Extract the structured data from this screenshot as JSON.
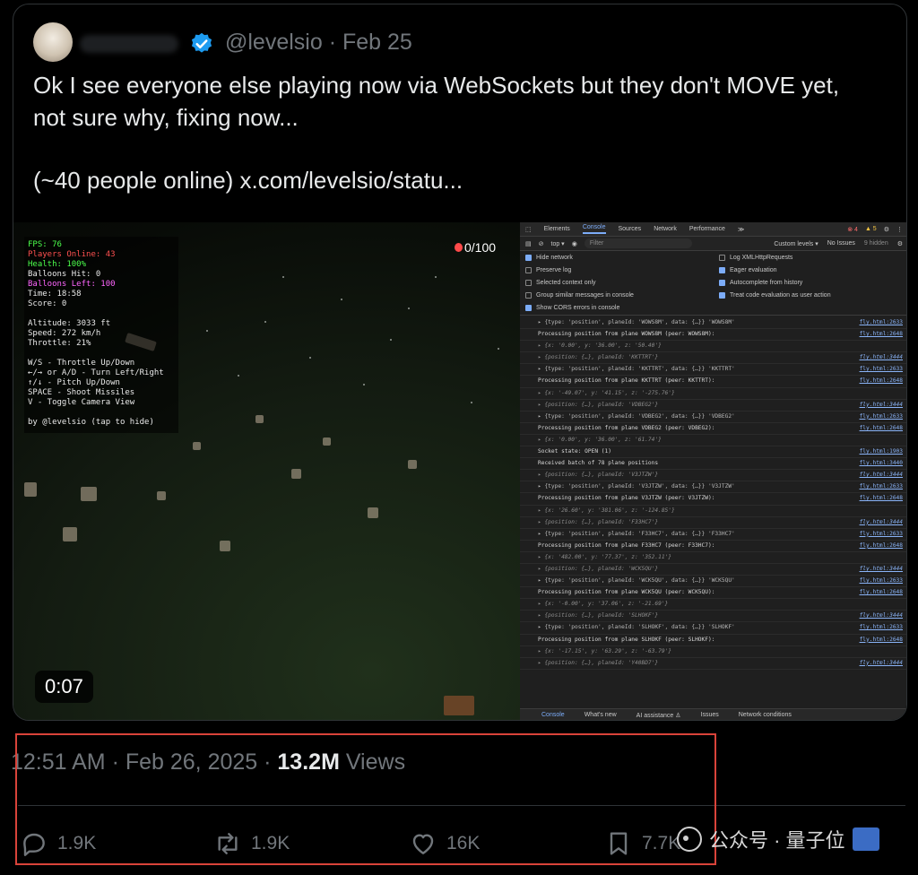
{
  "tweet": {
    "handle_date": "@levelsio · Feb 25",
    "line1": "Ok I see everyone else playing now via WebSockets but they don't MOVE yet,",
    "line2": "not sure why, fixing now...",
    "line3": "(~40 people online)  x.com/levelsio/statu..."
  },
  "game": {
    "hud": {
      "fps": "FPS: 76",
      "players": "Players Online: 43",
      "health": "Health: 100%",
      "balloons_hit": "Balloons Hit: 0",
      "balloons_left": "Balloons Left: 100",
      "time": "Time: 18:58",
      "score": "Score: 0",
      "altitude": "Altitude: 3033 ft",
      "speed": "Speed: 272 km/h",
      "throttle": "Throttle: 21%",
      "ctrl1": "W/S - Throttle Up/Down",
      "ctrl2": "←/→ or A/D - Turn Left/Right",
      "ctrl3": "↑/↓ - Pitch Up/Down",
      "ctrl4": "SPACE - Shoot Missiles",
      "ctrl5": "V - Toggle Camera View",
      "credit": "by @levelsio (tap to hide)"
    },
    "balloon_counter": "0/100",
    "video_time": "0:07"
  },
  "devtools": {
    "tabs": [
      "Elements",
      "Console",
      "Sources",
      "Network",
      "Performance",
      "≫"
    ],
    "errors": "⊗ 4",
    "warnings": "▲ 5",
    "filter": {
      "context": "top ▾",
      "placeholder": "Filter",
      "levels": "Custom levels ▾",
      "issues": "No Issues",
      "hidden": "9 hidden"
    },
    "settings": {
      "hide_network": "Hide network",
      "log_xhr": "Log XMLHttpRequests",
      "preserve_log": "Preserve log",
      "eager_eval": "Eager evaluation",
      "selected_context": "Selected context only",
      "autocomplete": "Autocomplete from history",
      "group_similar": "Group similar messages in console",
      "treat_eval": "Treat code evaluation as user action",
      "cors_errors": "Show CORS errors in console"
    },
    "logs": [
      {
        "text": "▸ {type: 'position', planeId: 'WOWS8M', data: {…}} 'WOWS8M'",
        "src": "fly.html:2633"
      },
      {
        "text": "Processing position from plane WOWS8M (peer: WOWS8M):",
        "src": "fly.html:2648"
      },
      {
        "text": "▸ {x: '0.00', y: '36.00', z: '50.40'}",
        "src": ""
      },
      {
        "text": "▸ {position: {…}, planeId: 'KKTTRT'}",
        "src": "fly.html:3444"
      },
      {
        "text": "▸ {type: 'position', planeId: 'KKTTRT', data: {…}} 'KKTTRT'",
        "src": "fly.html:2633"
      },
      {
        "text": "Processing position from plane KKTTRT (peer: KKTTRT):",
        "src": "fly.html:2648"
      },
      {
        "text": "▸ {x: '-49.07', y: '41.15', z: '-275.76'}",
        "src": ""
      },
      {
        "text": "▸ {position: {…}, planeId: 'VDBEG2'}",
        "src": "fly.html:3444"
      },
      {
        "text": "▸ {type: 'position', planeId: 'VDBEG2', data: {…}} 'VDBEG2'",
        "src": "fly.html:2633"
      },
      {
        "text": "Processing position from plane VDBEG2 (peer: VDBEG2):",
        "src": "fly.html:2648"
      },
      {
        "text": "▸ {x: '0.00', y: '36.00', z: '61.74'}",
        "src": ""
      },
      {
        "text": "Socket state: OPEN (1)",
        "src": "fly.html:1903"
      },
      {
        "text": "Received batch of 78 plane positions",
        "src": "fly.html:3440"
      },
      {
        "text": "▸ {position: {…}, planeId: 'V3JTZW'}",
        "src": "fly.html:3444"
      },
      {
        "text": "▸ {type: 'position', planeId: 'V3JTZW', data: {…}} 'V3JTZW'",
        "src": "fly.html:2633"
      },
      {
        "text": "Processing position from plane V3JTZW (peer: V3JTZW):",
        "src": "fly.html:2648"
      },
      {
        "text": "▸ {x: '26.60', y: '381.06', z: '-124.85'}",
        "src": ""
      },
      {
        "text": "▸ {position: {…}, planeId: 'F33HC7'}",
        "src": "fly.html:3444"
      },
      {
        "text": "▸ {type: 'position', planeId: 'F33HC7', data: {…}} 'F33HC7'",
        "src": "fly.html:2633"
      },
      {
        "text": "Processing position from plane F33HC7 (peer: F33HC7):",
        "src": "fly.html:2648"
      },
      {
        "text": "▸ {x: '482.00', y: '77.37', z: '352.11'}",
        "src": ""
      },
      {
        "text": "▸ {position: {…}, planeId: 'WCK5QU'}",
        "src": "fly.html:3444"
      },
      {
        "text": "▸ {type: 'position', planeId: 'WCK5QU', data: {…}} 'WCK5QU'",
        "src": "fly.html:2633"
      },
      {
        "text": "Processing position from plane WCK5QU (peer: WCK5QU):",
        "src": "fly.html:2648"
      },
      {
        "text": "▸ {x: '-0.00', y: '37.06', z: '-21.69'}",
        "src": ""
      },
      {
        "text": "▸ {position: {…}, planeId: 'SLHOKF'}",
        "src": "fly.html:3444"
      },
      {
        "text": "▸ {type: 'position', planeId: 'SLHOKF', data: {…}} 'SLHOKF'",
        "src": "fly.html:2633"
      },
      {
        "text": "Processing position from plane SLHOKF (peer: SLHOKF):",
        "src": "fly.html:2648"
      },
      {
        "text": "▸ {x: '-17.15', y: '63.29', z: '-63.79'}",
        "src": ""
      },
      {
        "text": "▸ {position: {…}, planeId: 'Y40BD7'}",
        "src": "fly.html:3444"
      }
    ],
    "bottom_tabs": [
      "Console",
      "What's new",
      "AI assistance ♙",
      "Issues",
      "Network conditions"
    ]
  },
  "meta": {
    "time_date": "12:51 AM · Feb 26, 2025 · ",
    "views_count": "13.2M",
    "views_label": " Views"
  },
  "actions": {
    "replies": "1.9K",
    "reposts": "1.9K",
    "likes": "16K",
    "bookmarks": "7.7K"
  },
  "watermark": {
    "text": "公众号 · 量子位"
  },
  "colors": {
    "background": "#000000",
    "text_primary": "#e7e9ea",
    "text_secondary": "#71767b",
    "verified_blue": "#1d9bf0",
    "highlight_box": "#d9433a",
    "hud_green": "#4cff4c",
    "hud_red": "#ff5050",
    "hud_pink": "#ff66ff"
  }
}
